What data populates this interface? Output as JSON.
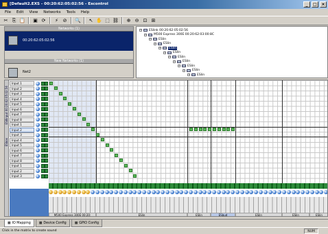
{
  "window": {
    "title": "[Default2.EXS - 00:20:62:05:02:56 - Escontrol"
  },
  "menu": [
    "File",
    "Edit",
    "View",
    "Networks",
    "Tools",
    "Help"
  ],
  "toolbar": [
    "cut-icon",
    "copy-icon",
    "paste-icon",
    "sep",
    "save-icon",
    "refresh-icon",
    "sep",
    "connect-icon",
    "disconnect-icon",
    "sep",
    "zoom-icon",
    "sep",
    "arrow-icon",
    "hand-icon",
    "select-icon",
    "link-icon",
    "sep",
    "zoom-in-icon",
    "zoom-out-icon",
    "zoom-fit-icon",
    "zoom-all-icon"
  ],
  "networks_panel": {
    "header": "Networks (1)",
    "selected_device": "00:20:62:05:02:56",
    "new_header": "New Networks (1)",
    "new_device": "Net2"
  },
  "tree": [
    {
      "label": "ESlink 00:20:62:05:02:56",
      "indent": 0
    },
    {
      "label": "M500 Express 300E 00:20:62:03:00:8C",
      "indent": 1
    },
    {
      "label": "ESlin",
      "indent": 2
    },
    {
      "label": "ESlin",
      "indent": 3
    },
    {
      "label": "ESlin",
      "indent": 4,
      "selected": true
    },
    {
      "label": "ESlin",
      "indent": 5
    },
    {
      "label": "ESlin",
      "indent": 6
    },
    {
      "label": "ESlin",
      "indent": 7
    },
    {
      "label": "ESlin",
      "indent": 8
    },
    {
      "label": "ESlin",
      "indent": 9
    },
    {
      "label": "ESlin",
      "indent": 10
    }
  ],
  "matrix": {
    "side_labels": [
      "ES8input 00:20:62:05:02:56",
      "ESbox"
    ],
    "inputs": [
      "Input 1",
      "Input 2",
      "Input 3",
      "Input 4",
      "Input 5",
      "Input 6",
      "Input 7",
      "Input 8",
      "Input 1",
      "Input 2",
      "Input 3",
      "Input 4",
      "Input 5",
      "Input 6",
      "Input 7",
      "Input 8",
      "Input 1",
      "Input 2",
      "Input 3"
    ],
    "highlighted_input": 9,
    "output_group_labels": [
      "M500 Express 300E 00:20:",
      "ESlin",
      "ESlin",
      "ESbud",
      "ESlin",
      "ESlin",
      "ESlin"
    ],
    "highlighted_output_group": 3
  },
  "tabs": [
    "IO Mapping",
    "Device Config",
    "GPIO Config"
  ],
  "active_tab": 0,
  "status": {
    "hint": "Click in the matrix to create sound",
    "num": "NUM"
  }
}
